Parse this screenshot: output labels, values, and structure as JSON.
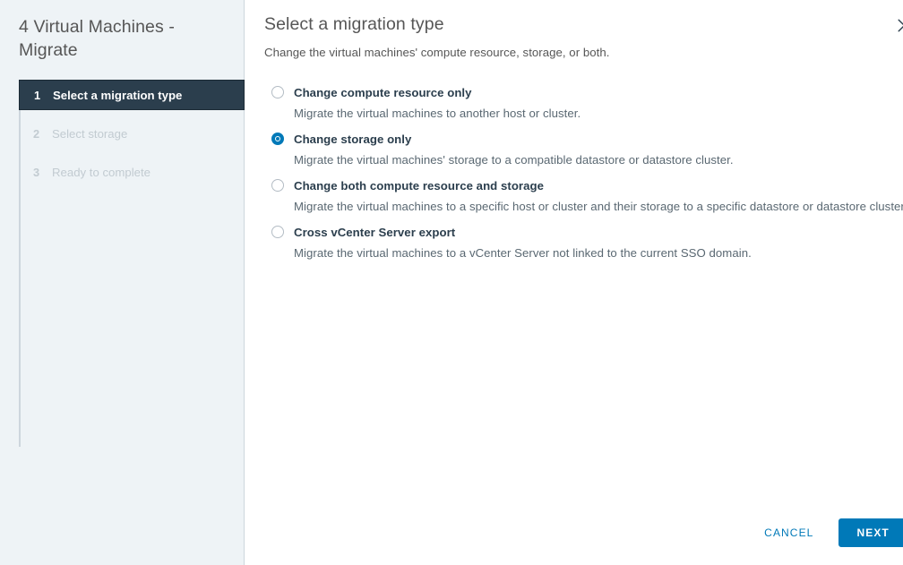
{
  "sidebar": {
    "title": "4 Virtual Machines - Migrate",
    "steps": [
      {
        "num": "1",
        "label": "Select a migration type",
        "state": "active"
      },
      {
        "num": "2",
        "label": "Select storage",
        "state": "inactive"
      },
      {
        "num": "3",
        "label": "Ready to complete",
        "state": "inactive"
      }
    ]
  },
  "content": {
    "title": "Select a migration type",
    "subtitle": "Change the virtual machines' compute resource, storage, or both.",
    "close_icon": "close-icon",
    "options": [
      {
        "label": "Change compute resource only",
        "description": "Migrate the virtual machines to another host or cluster.",
        "selected": false
      },
      {
        "label": "Change storage only",
        "description": "Migrate the virtual machines' storage to a compatible datastore or datastore cluster.",
        "selected": true
      },
      {
        "label": "Change both compute resource and storage",
        "description": "Migrate the virtual machines to a specific host or cluster and their storage to a specific datastore or datastore cluster.",
        "selected": false
      },
      {
        "label": "Cross vCenter Server export",
        "description": "Migrate the virtual machines to a vCenter Server not linked to the current SSO domain.",
        "selected": false
      }
    ]
  },
  "footer": {
    "cancel_label": "CANCEL",
    "next_label": "NEXT"
  },
  "colors": {
    "accent": "#0079b8",
    "sidebar_bg": "#eef3f6",
    "active_step_bg": "#2b3e4d",
    "inactive_step_text": "#c2cbd1",
    "body_text": "#565656"
  }
}
